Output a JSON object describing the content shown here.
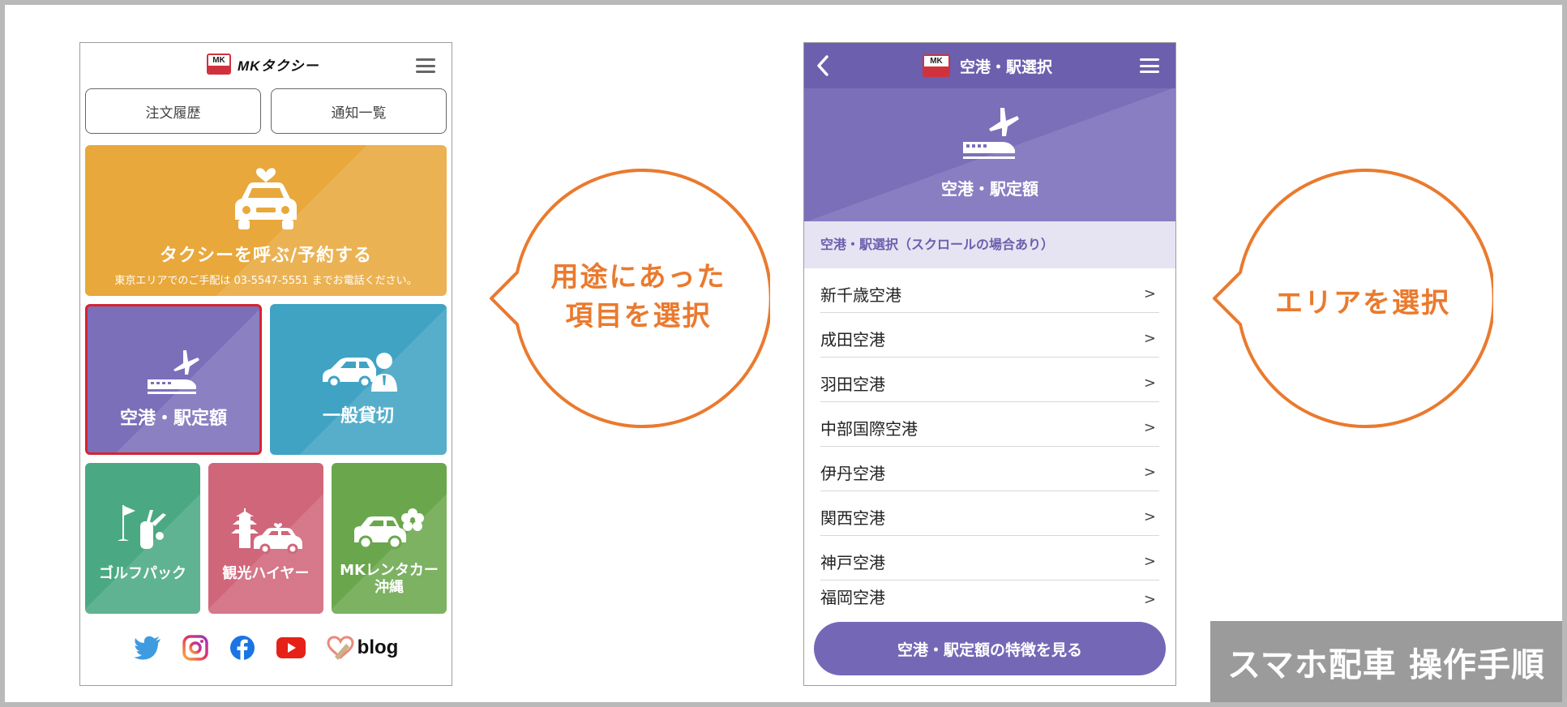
{
  "left_phone": {
    "logo_badge": "MK",
    "logo_text": "MKタクシー",
    "menu_icon": "hamburger-icon",
    "tabs": [
      {
        "label": "注文履歴"
      },
      {
        "label": "通知一覧"
      }
    ],
    "call_tile": {
      "title": "タクシーを呼ぶ/予約する",
      "note": "東京エリアでのご手配は 03-5547-5551 までお電話ください。",
      "color": "#e8a83c"
    },
    "service_tiles": [
      {
        "label": "空港・駅定額",
        "color": "#7b6fba",
        "selected": true,
        "icon": "plane-train-icon"
      },
      {
        "label": "一般貸切",
        "color": "#40a3c4",
        "selected": false,
        "icon": "car-chauffeur-icon"
      },
      {
        "label": "ゴルフパック",
        "color": "#4aa983",
        "selected": false,
        "icon": "golf-icon"
      },
      {
        "label": "観光ハイヤー",
        "color": "#d0667a",
        "selected": false,
        "icon": "pagoda-car-icon"
      },
      {
        "label_line1": "MKレンタカー",
        "label_line2": "沖縄",
        "color": "#6aa74c",
        "selected": false,
        "icon": "rental-car-hibiscus-icon"
      }
    ],
    "social": {
      "icons": [
        "twitter-icon",
        "instagram-icon",
        "facebook-icon",
        "youtube-icon"
      ],
      "blog_label": "blog"
    }
  },
  "bubble_left": {
    "line1": "用途にあった",
    "line2": "項目を選択",
    "color": "#ea7a2e"
  },
  "right_phone": {
    "header_title": "空港・駅選択",
    "back_icon": "chevron-left-icon",
    "hero_label": "空港・駅定額",
    "section_header": "空港・駅選択（スクロールの場合あり）",
    "airports": [
      "新千歳空港",
      "成田空港",
      "羽田空港",
      "中部国際空港",
      "伊丹空港",
      "関西空港",
      "神戸空港",
      "福岡空港"
    ],
    "chevron": ">",
    "cta_label": "空港・駅定額の特徴を見る",
    "accent": "#6c5fae"
  },
  "bubble_right": {
    "text": "エリアを選択",
    "color": "#ea7a2e"
  },
  "corner_label": "スマホ配車 操作手順"
}
